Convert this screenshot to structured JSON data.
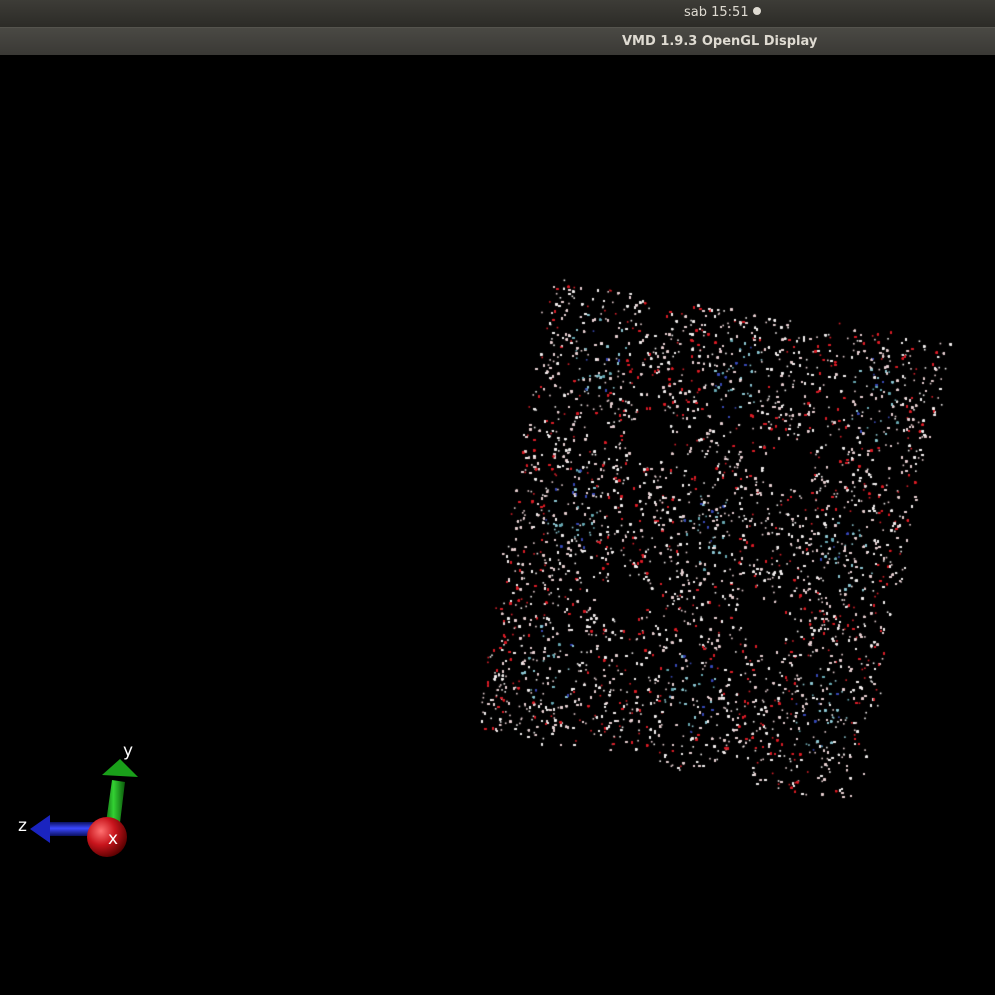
{
  "top_bar": {
    "clock": "sab 15:51"
  },
  "window": {
    "title": "VMD 1.9.3 OpenGL Display"
  },
  "viewport": {
    "background_color": "#000000",
    "molecule": {
      "rendering": "point cloud",
      "colors": {
        "base": "#e6cfd1",
        "oxygen_red": "#d8202a",
        "white": "#f2eeee",
        "cyan": "#8ec7d2",
        "blue": "#3a4bb5",
        "teal": "#6aa9b3"
      }
    },
    "axes": {
      "x_label": "x",
      "y_label": "y",
      "z_label": "z",
      "colors": {
        "x": "#c8141c",
        "y": "#1aa01a",
        "z": "#1a24c0"
      }
    }
  }
}
